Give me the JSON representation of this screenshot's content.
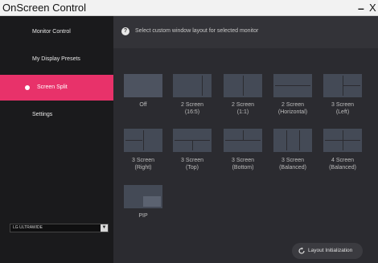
{
  "window": {
    "title": "OnScreen Control",
    "minimize_glyph": "–",
    "close_glyph": "X"
  },
  "sidebar": {
    "items": [
      {
        "label": "Monitor Control",
        "active": false
      },
      {
        "label": "My Display Presets",
        "active": false
      },
      {
        "label": "Screen Split",
        "active": true
      },
      {
        "label": "Settings",
        "active": false
      }
    ],
    "monitor_select": {
      "value": "LG ULTRAWIDE"
    }
  },
  "main": {
    "info_text": "Select custom window layout for selected monitor",
    "layouts": [
      {
        "label": "Off",
        "selected": true
      },
      {
        "label": "2 Screen\n(16:5)"
      },
      {
        "label": "2 Screen\n(1:1)"
      },
      {
        "label": "2 Screen\n(Horizontal)"
      },
      {
        "label": "3 Screen\n(Left)"
      },
      {
        "label": "3 Screen\n(Right)"
      },
      {
        "label": "3 Screen\n(Top)"
      },
      {
        "label": "3 Screen\n(Bottom)"
      },
      {
        "label": "3 Screen\n(Balanced)"
      },
      {
        "label": "4 Screen\n(Balanced)"
      },
      {
        "label": "PIP"
      }
    ],
    "init_button": "Layout Initialization"
  },
  "colors": {
    "accent": "#e8326a",
    "sidebar_bg": "#1a1a1c",
    "main_bg": "#2b2b30",
    "tile": "#444a56"
  }
}
